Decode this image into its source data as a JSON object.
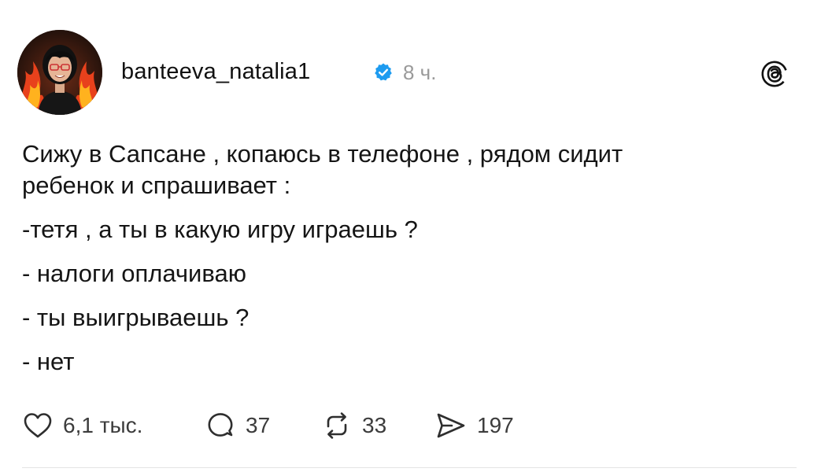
{
  "post": {
    "username": "banteeva_natalia1",
    "time": "8 ч.",
    "text_lines": [
      "Сижу в Сапсане , копаюсь в телефоне , рядом сидит",
      "ребенок и спрашивает :",
      "-тетя , а ты в какую игру играешь ?",
      "- налоги оплачиваю",
      "- ты выигрываешь ?",
      "- нет"
    ]
  },
  "actions": {
    "likes": "6,1 тыс.",
    "replies": "37",
    "reposts": "33",
    "shares": "197"
  },
  "icons": {
    "verified": "verified-badge-icon",
    "app": "threads-logo-icon",
    "like": "heart-icon",
    "reply": "comment-bubble-icon",
    "repost": "repost-arrows-icon",
    "share": "send-icon"
  },
  "colors": {
    "verified_blue": "#1d9bf0",
    "muted_text": "#9a9a9a"
  }
}
